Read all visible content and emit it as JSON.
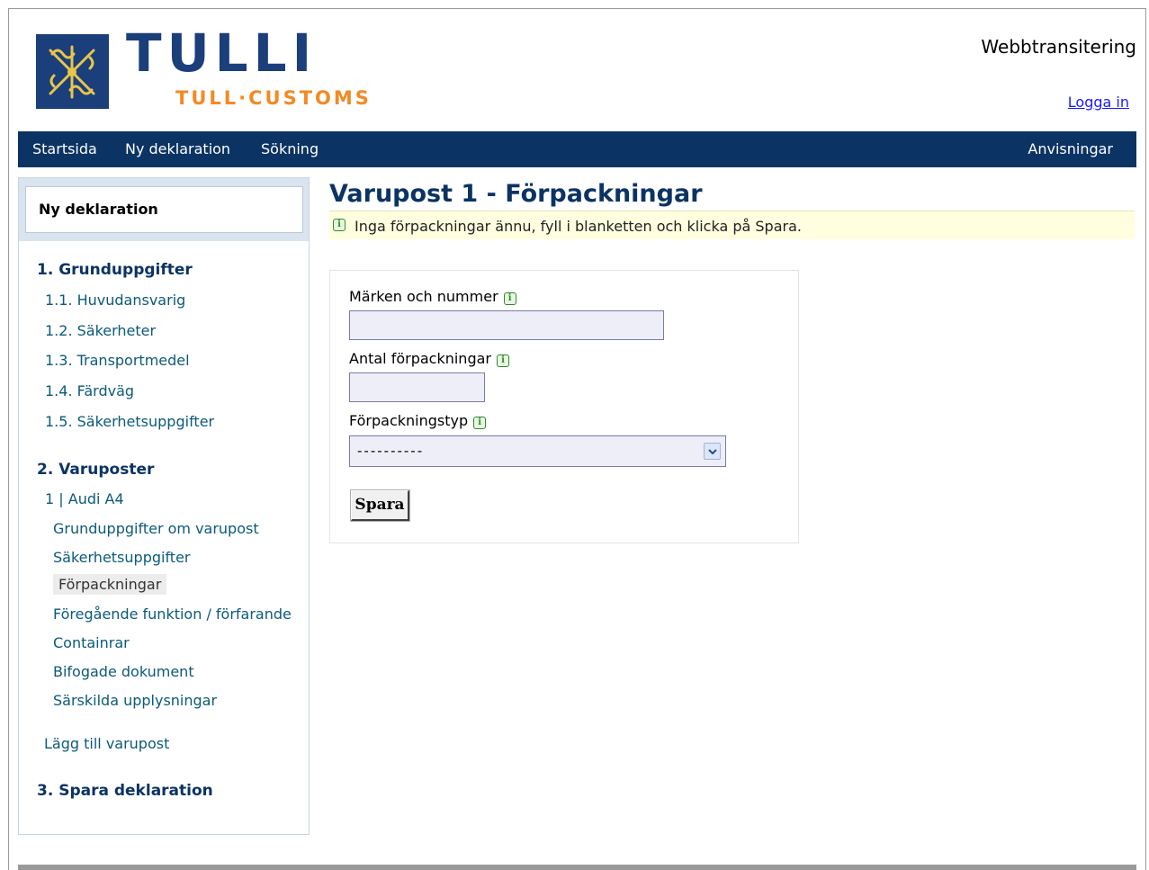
{
  "header": {
    "logo_main": "TULLI",
    "logo_sub": "TULL·CUSTOMS",
    "app_title": "Webbtransitering",
    "login_label": "Logga in"
  },
  "nav": {
    "items": [
      "Startsida",
      "Ny deklaration",
      "Sökning"
    ],
    "help": "Anvisningar"
  },
  "sidebar": {
    "heading": "Ny deklaration",
    "section1": "1. Grunduppgifter",
    "section1_items": [
      "1.1. Huvudansvarig",
      "1.2. Säkerheter",
      "1.3. Transportmedel",
      "1.4. Färdväg",
      "1.5. Säkerhetsuppgifter"
    ],
    "section2": "2. Varuposter",
    "item_name": "1 | Audi A4",
    "item_subitems": [
      "Grunduppgifter om varupost",
      "Säkerhetsuppgifter",
      "Förpackningar",
      "Föregående funktion / förfarande",
      "Containrar",
      "Bifogade dokument",
      "Särskilda upplysningar"
    ],
    "active_subitem": "Förpackningar",
    "add_item": "Lägg till varupost",
    "section3": "3. Spara deklaration"
  },
  "main": {
    "title": "Varupost 1 - Förpackningar",
    "info_message": "Inga förpackningar ännu, fyll i blanketten och klicka på Spara.",
    "fields": {
      "marks_label": "Märken och nummer",
      "marks_value": "",
      "count_label": "Antal förpackningar",
      "count_value": "",
      "type_label": "Förpackningstyp",
      "type_selected": "----------"
    },
    "save_label": "Spara"
  },
  "colors": {
    "brand_blue": "#0b3363",
    "brand_orange": "#f28a24",
    "info_bg": "#ffffe0",
    "info_icon": "#2f8a2f"
  },
  "icons": {
    "info": "info-icon",
    "select_arrow": "chevron-down-icon",
    "logo": "tulli-emblem-icon"
  }
}
